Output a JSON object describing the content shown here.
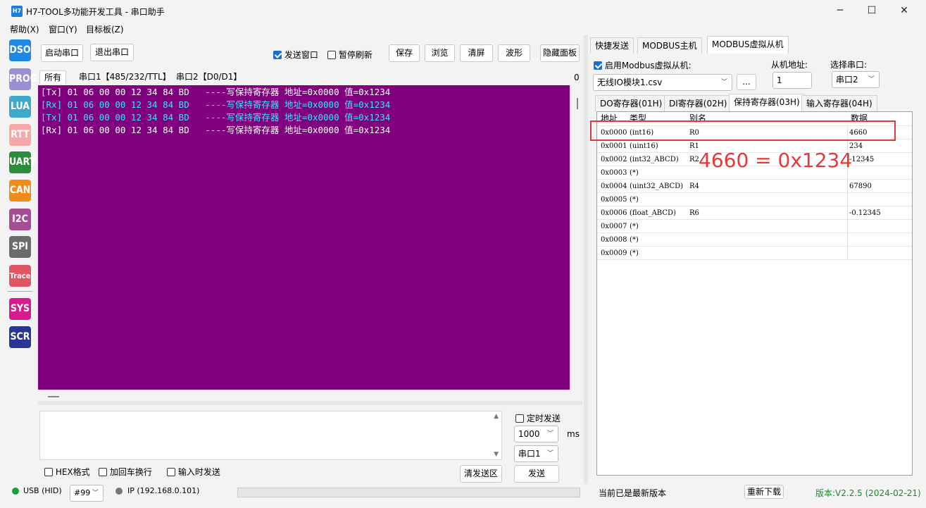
{
  "window": {
    "title": "H7-TOOL多功能开发工具 - 串口助手",
    "icon_text": "H7",
    "minimize": "─",
    "maximize": "☐",
    "close": "✕"
  },
  "menu": [
    "帮助(X)",
    "窗口(Y)",
    "目标板(Z)"
  ],
  "sidebar": [
    "DSO",
    "PROG",
    "LUA",
    "RTT",
    "UART",
    "CAN",
    "I2C",
    "SPI",
    "Trace",
    "SYS",
    "SCR"
  ],
  "toolbar": {
    "start_port": "启动串口",
    "exit_port": "退出串口",
    "send_window": "发送窗口",
    "pause_refresh": "暂停刷新",
    "save": "保存",
    "browse": "浏览",
    "clear": "清屏",
    "waveform": "波形",
    "hide_panel": "隐藏面板"
  },
  "tabs": [
    "所有",
    "串口1【485/232/TTL】",
    "串口2【D0/D1】"
  ],
  "tab_count": "0",
  "terminal": {
    "lines": [
      "[Tx] 01 06 00 00 12 34 84 BD   ----写保持寄存器 地址=0x0000 值=0x1234",
      "[Rx] 01 06 00 00 12 34 84 BD   ----写保持寄存器 地址=0x0000 值=0x1234",
      "[Tx] 01 06 00 00 12 34 84 BD   ----写保持寄存器 地址=0x0000 值=0x1234",
      "[Rx] 01 06 00 00 12 34 84 BD   ----写保持寄存器 地址=0x0000 值=0x1234"
    ],
    "line_colors": [
      "#ffffff",
      "#40e0ff",
      "#40e0ff",
      "#ffffff"
    ],
    "bg": "#800080"
  },
  "send": {
    "timed_send": "定时发送",
    "interval": "1000",
    "ms": "ms",
    "port": "串口1",
    "hex": "HEX格式",
    "crlf": "加回车换行",
    "send_on_input": "输入时发送",
    "clear_send": "清发送区",
    "send": "发送"
  },
  "right": {
    "tabs": [
      "快捷发送",
      "MODBUS主机",
      "MODBUS虚拟从机"
    ],
    "enable": "启用Modbus虚拟从机:",
    "slave_addr_label": "从机地址:",
    "port_label": "选择串口:",
    "file": "无线IO模块1.csv",
    "browse_btn": "...",
    "slave_addr": "1",
    "port": "串口2",
    "reg_tabs": [
      "DO寄存器(01H)",
      "DI寄存器(02H)",
      "保持寄存器(03H)",
      "输入寄存器(04H)"
    ],
    "grid_headers": [
      "地址",
      "类型",
      "别名",
      "数据"
    ],
    "rows": [
      [
        "0x0000",
        "(int16)",
        "R0",
        "4660"
      ],
      [
        "0x0001",
        "(uint16)",
        "R1",
        "234"
      ],
      [
        "0x0002",
        "(int32_ABCD)",
        "R2",
        "-12345"
      ],
      [
        "0x0003",
        "(*)",
        "",
        ""
      ],
      [
        "0x0004",
        "(uint32_ABCD)",
        "R4",
        "67890"
      ],
      [
        "0x0005",
        "(*)",
        "",
        ""
      ],
      [
        "0x0006",
        "(float_ABCD)",
        "R6",
        "-0.12345"
      ],
      [
        "0x0007",
        "(*)",
        "",
        ""
      ],
      [
        "0x0008",
        "(*)",
        "",
        ""
      ],
      [
        "0x0009",
        "(*)",
        "",
        ""
      ]
    ],
    "annotation": "4660 = 0x1234",
    "annotation_color": "#e53935"
  },
  "status": {
    "usb": "USB (HID)",
    "device": "#99",
    "ip": "IP (192.168.0.101)",
    "version_msg": "当前已是最新版本",
    "redownload": "重新下载",
    "version": "版本:V2.2.5 (2024-02-21)"
  },
  "sidebar_colors": [
    "#1e88e5",
    "#9b8fd4",
    "#3fa9c9",
    "#f4a8a8",
    "#2e8b3e",
    "#f08c1c",
    "#a64d96",
    "#6b6b6b",
    "#e25563",
    "#d81b8c",
    "#283593"
  ]
}
